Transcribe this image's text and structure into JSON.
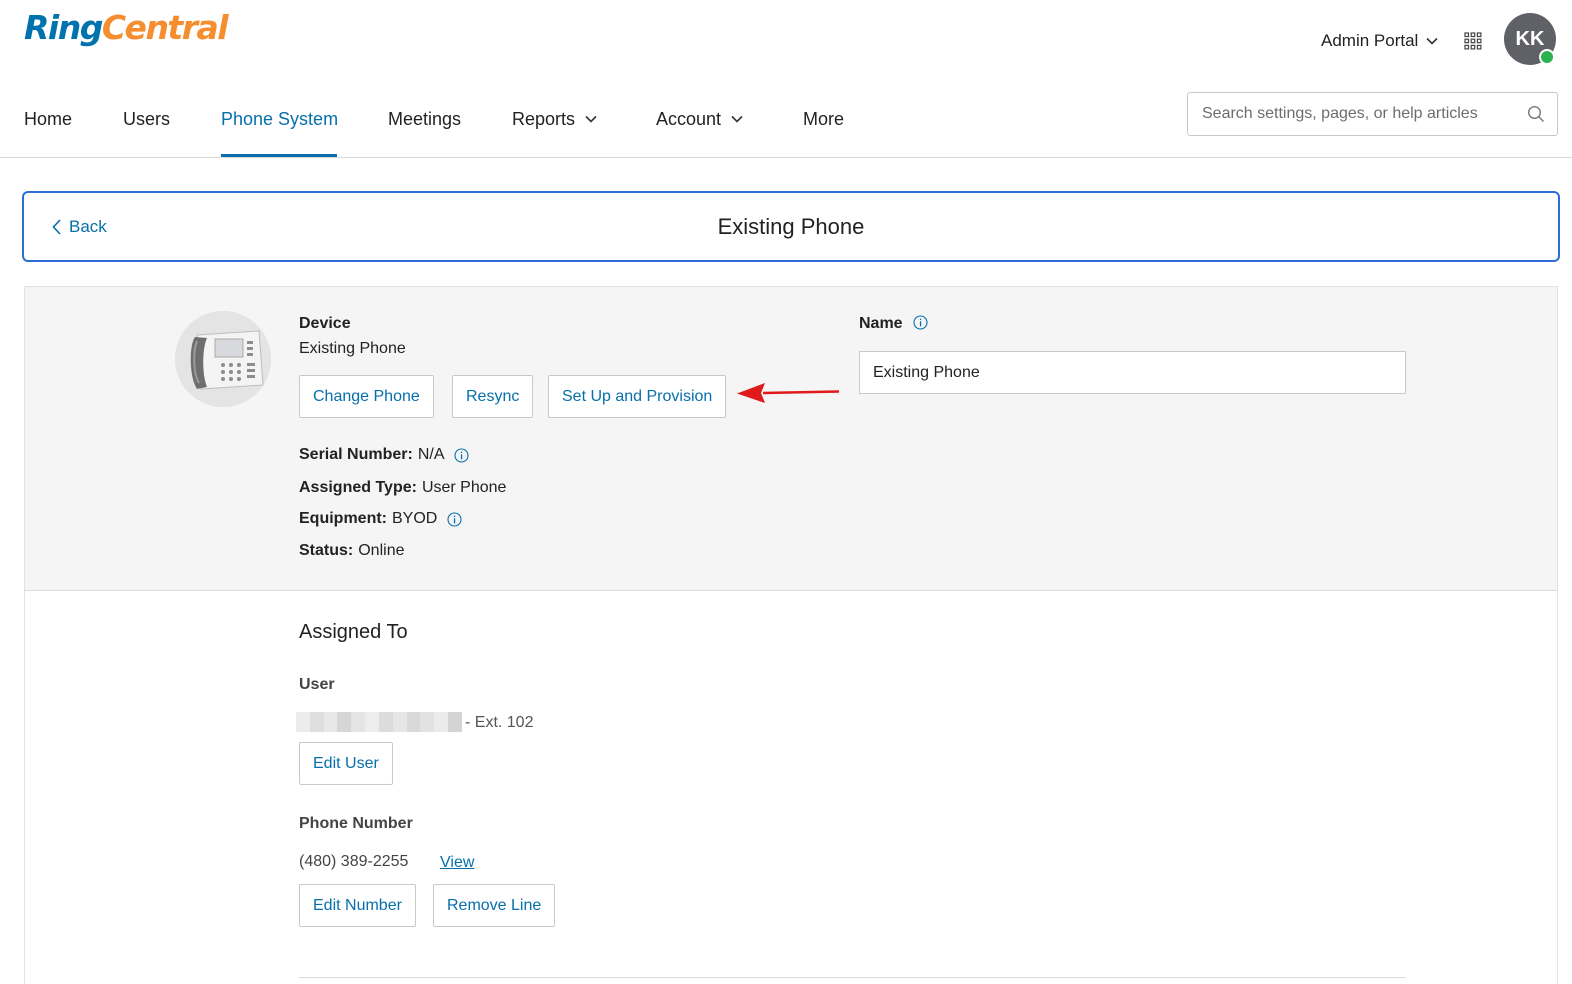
{
  "brand": {
    "ring": "Ring",
    "central": "Central",
    "ring_color": "#0073ae",
    "central_color": "#f68d2e"
  },
  "header": {
    "portal_label": "Admin Portal",
    "apps_icon": "grid-icon",
    "avatar_initials": "KK",
    "status_color": "#2bb24c"
  },
  "nav": {
    "items": [
      {
        "label": "Home",
        "dropdown": false
      },
      {
        "label": "Users",
        "dropdown": false
      },
      {
        "label": "Phone System",
        "dropdown": false,
        "active": true
      },
      {
        "label": "Meetings",
        "dropdown": false
      },
      {
        "label": "Reports",
        "dropdown": true
      },
      {
        "label": "Account",
        "dropdown": true
      },
      {
        "label": "More",
        "dropdown": false
      }
    ],
    "accent_color": "#066fac"
  },
  "search": {
    "placeholder": "Search settings, pages, or help articles",
    "icon": "search-icon"
  },
  "titlebar": {
    "back_label": "Back",
    "title": "Existing Phone"
  },
  "device": {
    "label": "Device",
    "value": "Existing Phone",
    "buttons": {
      "change": "Change Phone",
      "resync": "Resync",
      "provision": "Set Up and Provision"
    },
    "details": {
      "serial_label": "Serial Number:",
      "serial_value": "N/A",
      "type_label": "Assigned Type:",
      "type_value": "User Phone",
      "equipment_label": "Equipment:",
      "equipment_value": "BYOD",
      "status_label": "Status:",
      "status_value": "Online"
    }
  },
  "name_field": {
    "label": "Name",
    "value": "Existing Phone"
  },
  "assigned": {
    "title": "Assigned To",
    "user_label": "User",
    "user_ext": "- Ext. 102",
    "edit_user": "Edit User",
    "phone_label": "Phone Number",
    "phone_value": "(480) 389-2255",
    "view_link": "View",
    "edit_number": "Edit Number",
    "remove_line": "Remove Line"
  }
}
